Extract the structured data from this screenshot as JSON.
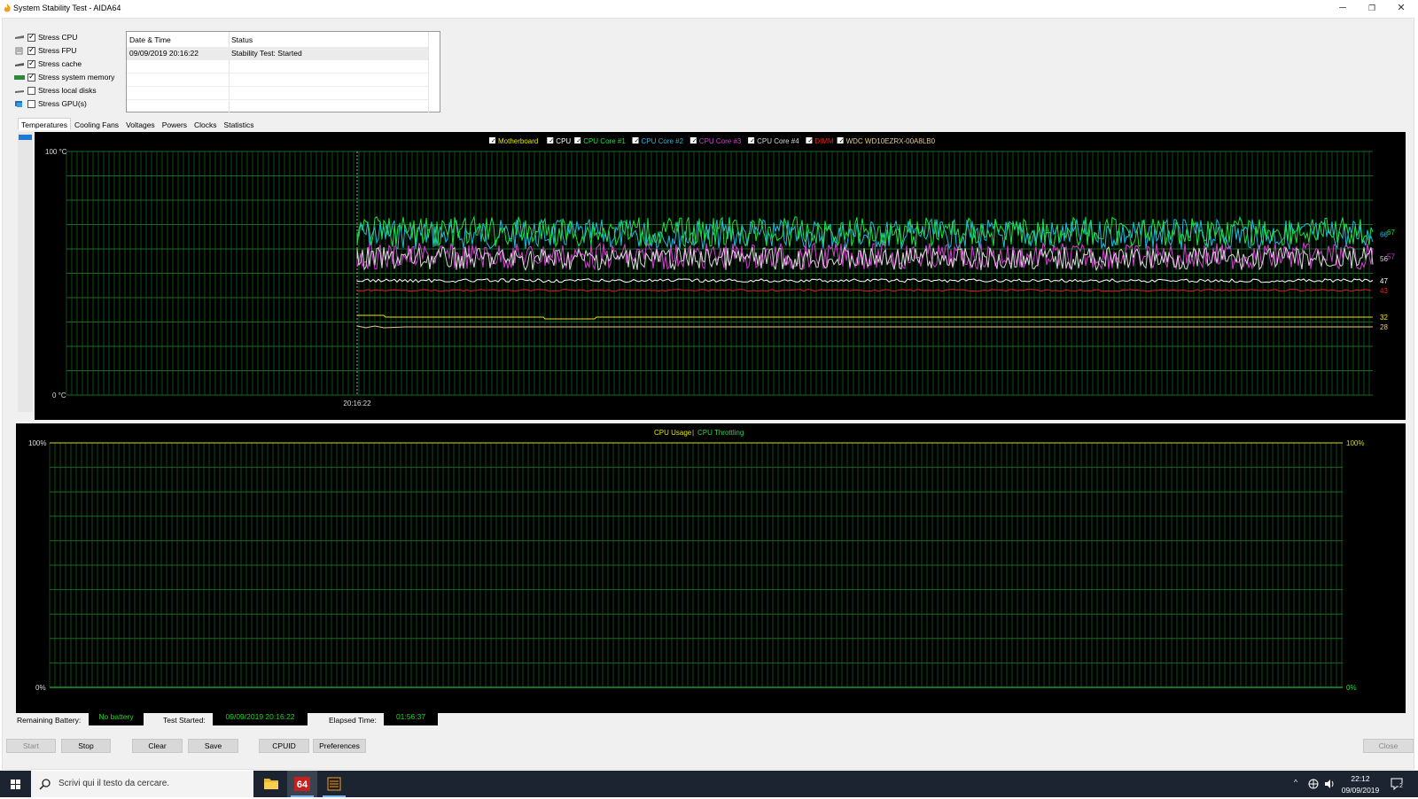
{
  "window": {
    "title": "System Stability Test - AIDA64",
    "controls": [
      "minimize",
      "restore",
      "close"
    ]
  },
  "stress": [
    {
      "label": "Stress CPU",
      "checked": true
    },
    {
      "label": "Stress FPU",
      "checked": true
    },
    {
      "label": "Stress cache",
      "checked": true
    },
    {
      "label": "Stress system memory",
      "checked": true
    },
    {
      "label": "Stress local disks",
      "checked": false
    },
    {
      "label": "Stress GPU(s)",
      "checked": false
    }
  ],
  "status_table": {
    "headers": [
      "Date & Time",
      "Status"
    ],
    "rows": [
      [
        "09/09/2019 20:16:22",
        "Stability Test: Started"
      ]
    ]
  },
  "tabs": [
    "Temperatures",
    "Cooling Fans",
    "Voltages",
    "Powers",
    "Clocks",
    "Statistics"
  ],
  "active_tab": "Temperatures",
  "temp_chart": {
    "chart_data": {
      "type": "line",
      "y_top_label": "100 °C",
      "y_bottom_label": "0 °C",
      "ylim": [
        0,
        100
      ],
      "x_marker_label": "20:16:22",
      "legend": [
        {
          "name": "Motherboard",
          "color": "#e6e600"
        },
        {
          "name": "CPU",
          "color": "#ffffff"
        },
        {
          "name": "CPU Core #1",
          "color": "#22dd44"
        },
        {
          "name": "CPU Core #2",
          "color": "#22b8dd"
        },
        {
          "name": "CPU Core #3",
          "color": "#d040d0"
        },
        {
          "name": "CPU Core #4",
          "color": "#d8d8d8"
        },
        {
          "name": "DIMM",
          "color": "#dd2222"
        },
        {
          "name": "WDC WD10EZRX-00A8LB0",
          "color": "#e8c890"
        }
      ],
      "end_values": [
        {
          "label": "67",
          "color": "#22dd44"
        },
        {
          "label": "66",
          "color": "#22b8dd"
        },
        {
          "label": "57",
          "color": "#d040d0"
        },
        {
          "label": "56",
          "color": "#d8d8d8"
        },
        {
          "label": "47",
          "color": "#ffffff"
        },
        {
          "label": "43",
          "color": "#dd2222"
        },
        {
          "label": "32",
          "color": "#e6e600"
        },
        {
          "label": "28",
          "color": "#e8c890"
        }
      ]
    }
  },
  "usage_chart": {
    "chart_data": {
      "type": "line",
      "legend": [
        {
          "name": "CPU Usage",
          "color": "#e6e600"
        },
        {
          "name": "CPU Throttling",
          "color": "#22dd44"
        }
      ],
      "y_left_top": "100%",
      "y_left_bottom": "0%",
      "y_right_top": "100%",
      "y_right_bottom": "0%",
      "ylim": [
        0,
        100
      ]
    }
  },
  "footer": {
    "battery_label": "Remaining Battery:",
    "battery_value": "No battery",
    "started_label": "Test Started:",
    "started_value": "09/09/2019 20:16:22",
    "elapsed_label": "Elapsed Time:",
    "elapsed_value": "01:56:37"
  },
  "buttons": {
    "start": "Start",
    "stop": "Stop",
    "clear": "Clear",
    "save": "Save",
    "cpuid": "CPUID",
    "preferences": "Preferences",
    "close": "Close"
  },
  "taskbar": {
    "search_placeholder": "Scrivi qui il testo da cercare.",
    "time": "22:12",
    "date": "09/09/2019",
    "notification_count": "2"
  }
}
